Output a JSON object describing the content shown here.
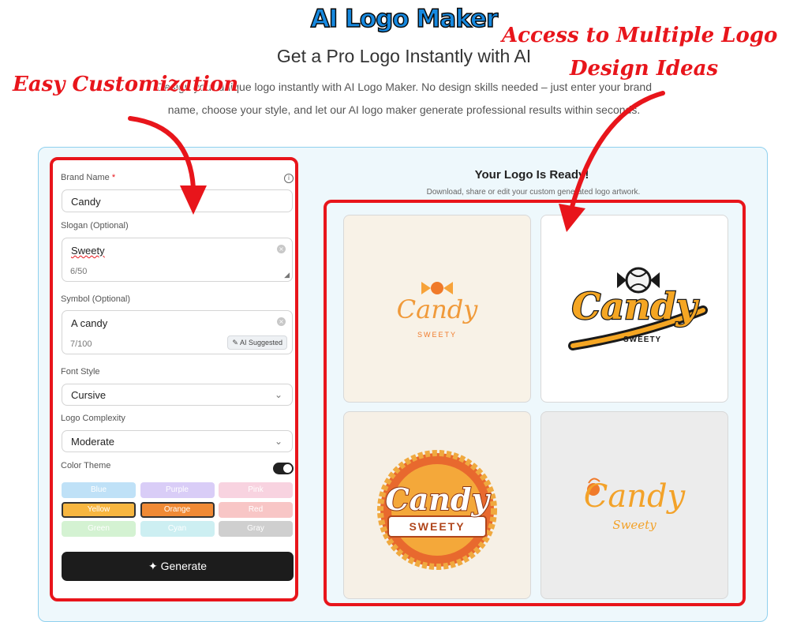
{
  "header": {
    "brand": "AI Logo Maker",
    "title": "Get a Pro Logo Instantly with AI",
    "description": "Design your unique logo instantly with AI Logo Maker. No design skills needed – just enter your brand name, choose your style, and let our AI logo maker generate professional results within seconds."
  },
  "annotations": {
    "left": "Easy Customization",
    "right_line1": "Access to Multiple Logo",
    "right_line2": "Design Ideas",
    "color": "#e8151b"
  },
  "form": {
    "brand_name": {
      "label": "Brand Name",
      "required_mark": "*",
      "value": "Candy"
    },
    "slogan": {
      "label": "Slogan (Optional)",
      "value": "Sweety",
      "counter": "6/50"
    },
    "symbol": {
      "label": "Symbol (Optional)",
      "value": "A candy",
      "counter": "7/100",
      "ai_badge": "AI Suggested"
    },
    "font_style": {
      "label": "Font Style",
      "value": "Cursive"
    },
    "logo_complexity": {
      "label": "Logo Complexity",
      "value": "Moderate"
    },
    "color_theme": {
      "label": "Color Theme",
      "enabled": true,
      "options": [
        {
          "name": "Blue",
          "color": "#bfe1f7",
          "selected": false
        },
        {
          "name": "Purple",
          "color": "#d9cdf7",
          "selected": false
        },
        {
          "name": "Pink",
          "color": "#f8d3e0",
          "selected": false
        },
        {
          "name": "Yellow",
          "color": "#f7b640",
          "selected": true
        },
        {
          "name": "Orange",
          "color": "#f08a35",
          "selected": true
        },
        {
          "name": "Red",
          "color": "#f8c6c6",
          "selected": false
        },
        {
          "name": "Green",
          "color": "#d4f2d2",
          "selected": false
        },
        {
          "name": "Cyan",
          "color": "#cdeff2",
          "selected": false
        },
        {
          "name": "Gray",
          "color": "#cfcfcf",
          "selected": false
        }
      ]
    },
    "generate_label": "Generate"
  },
  "results": {
    "title": "Your Logo Is Ready!",
    "description": "Download, share or edit your custom generated logo artwork.",
    "logos": [
      {
        "name": "Candy",
        "tagline": "SWEETY",
        "style": "minimal-wrapper"
      },
      {
        "name": "Candy",
        "tagline": "SWEETY",
        "style": "bold-script"
      },
      {
        "name": "Candy",
        "tagline": "SWEETY",
        "style": "badge"
      },
      {
        "name": "Candy",
        "tagline": "Sweety",
        "style": "swirl-script"
      }
    ]
  }
}
